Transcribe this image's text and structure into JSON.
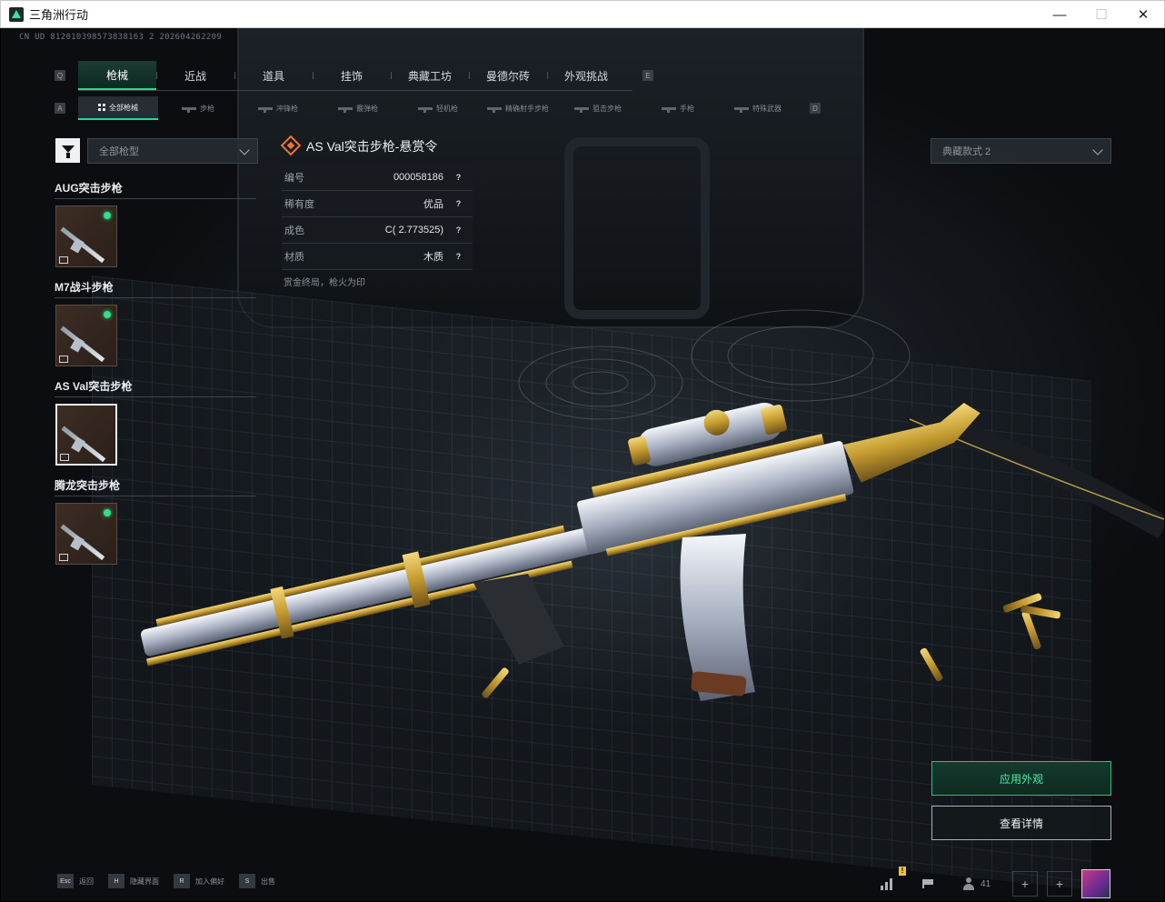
{
  "window": {
    "title": "三角洲行动",
    "minimize": "—",
    "maximize": "☐",
    "close": "✕"
  },
  "uid": "CN UD 812010398573838163 2 202604262209",
  "main_tabs": {
    "left_key": "Q",
    "right_key": "E",
    "items": [
      {
        "label": "枪械",
        "active": true
      },
      {
        "label": "近战"
      },
      {
        "label": "道具"
      },
      {
        "label": "挂饰"
      },
      {
        "label": "典藏工坊"
      },
      {
        "label": "曼德尔砖"
      },
      {
        "label": "外观挑战"
      }
    ]
  },
  "sub_tabs": {
    "left_key": "A",
    "right_key": "D",
    "items": [
      {
        "label": "全部枪械",
        "active": true
      },
      {
        "label": "步枪"
      },
      {
        "label": "冲锋枪"
      },
      {
        "label": "霰弹枪"
      },
      {
        "label": "轻机枪"
      },
      {
        "label": "精确射手步枪"
      },
      {
        "label": "狙击步枪"
      },
      {
        "label": "手枪"
      },
      {
        "label": "特殊武器"
      }
    ]
  },
  "filter": {
    "type_select": "全部枪型",
    "style_select": "典藏款式 2"
  },
  "weapons": [
    {
      "name": "AUG突击步枪",
      "equipped": true
    },
    {
      "name": "M7战斗步枪",
      "equipped": true
    },
    {
      "name": "AS Val突击步枪",
      "equipped": false,
      "selected": true
    },
    {
      "name": "腾龙突击步枪",
      "equipped": true
    }
  ],
  "skin": {
    "title": "AS Val突击步枪-悬赏令",
    "properties": [
      {
        "key": "编号",
        "value": "000058186"
      },
      {
        "key": "稀有度",
        "value": "优品"
      },
      {
        "key": "成色",
        "value": "C( 2.773525)"
      },
      {
        "key": "材质",
        "value": "木质"
      }
    ],
    "help_glyph": "?",
    "motto": "赏金终局，枪火为印"
  },
  "actions": {
    "apply": "应用外观",
    "details": "查看详情"
  },
  "bottom_hints": [
    {
      "key": "Esc",
      "label": "返回"
    },
    {
      "key": "H",
      "label": "隐藏界面"
    },
    {
      "key": "R",
      "label": "加入偏好"
    },
    {
      "key": "S",
      "label": "出售"
    }
  ],
  "hud": {
    "new_badge": "!",
    "friends_count": "41",
    "plus": "+"
  },
  "colors": {
    "accent_green": "#29d88f",
    "skin_icon_orange": "#e8743a",
    "equipped_dot": "#2fe08a"
  }
}
